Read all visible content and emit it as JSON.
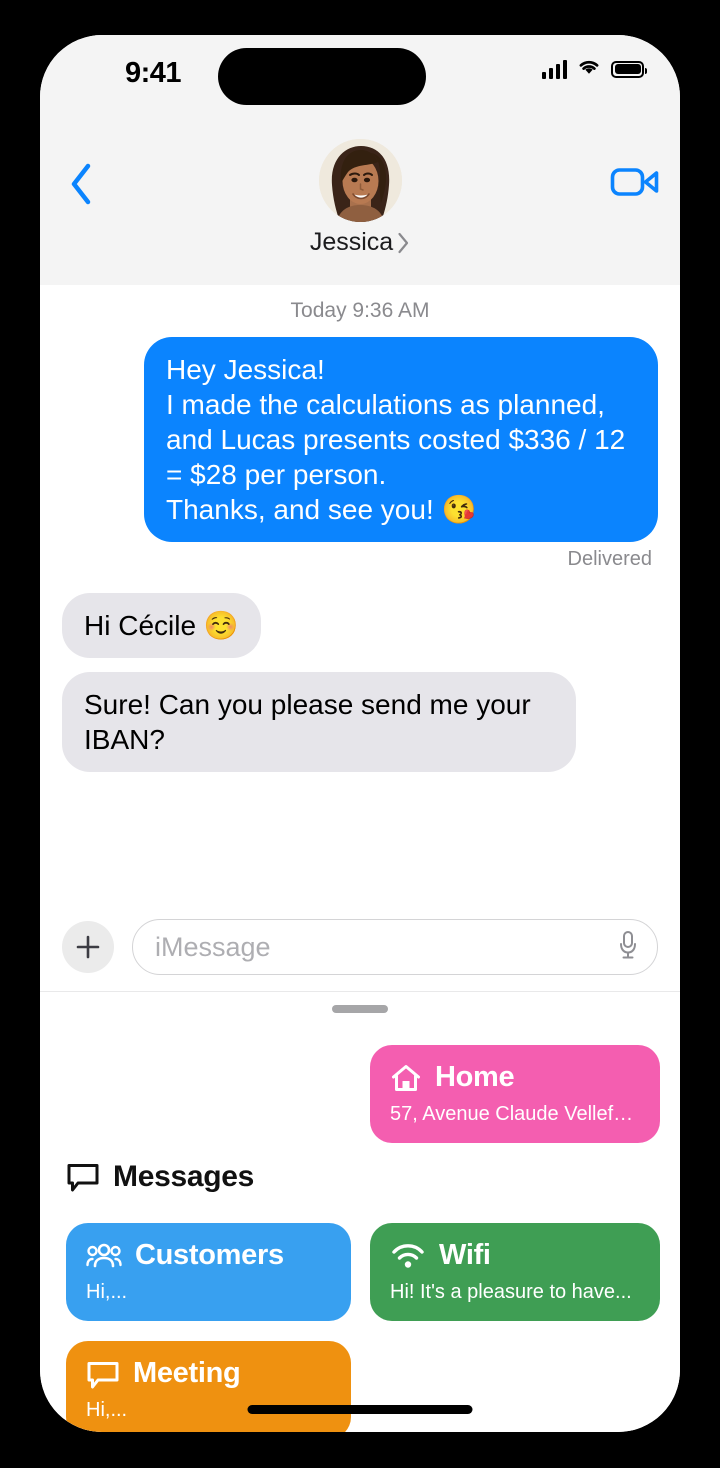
{
  "status_bar": {
    "time": "9:41",
    "signal_icon": "cellular-signal-icon",
    "wifi_icon": "wifi-icon",
    "battery_icon": "battery-icon"
  },
  "chat_header": {
    "back_icon": "back-chevron-icon",
    "contact_name": "Jessica",
    "contact_chevron_icon": "chevron-right-icon",
    "avatar_alt": "avatar",
    "video_icon": "video-camera-icon"
  },
  "conversation": {
    "day_stamp": "Today 9:36 AM",
    "delivered_label": "Delivered",
    "messages": [
      {
        "direction": "outgoing",
        "text": "Hey Jessica!\nI made the calculations as planned, and Lucas presents costed $336 / 12 = $28 per person.\nThanks, and see you! 😘"
      },
      {
        "direction": "incoming",
        "text": "Hi Cécile ☺️"
      },
      {
        "direction": "incoming",
        "text": "Sure! Can you please send me your IBAN?"
      }
    ]
  },
  "input_bar": {
    "plus_icon": "plus-icon",
    "placeholder": "iMessage",
    "value": "",
    "mic_icon": "microphone-icon"
  },
  "bottom_sheet": {
    "drag_handle": "drag-handle",
    "home_card": {
      "icon": "house-icon",
      "title": "Home",
      "subtitle": "57, Avenue Claude Vellefa...",
      "color": "#f45eb0"
    },
    "section": {
      "icon": "speech-bubble-icon",
      "title": "Messages"
    },
    "cards": [
      {
        "icon": "people-group-icon",
        "title": "Customers",
        "subtitle": "Hi,...",
        "color": "#38a0f0"
      },
      {
        "icon": "wifi-icon",
        "title": "Wifi",
        "subtitle": "Hi! It's a pleasure to have...",
        "color": "#3f9e54"
      },
      {
        "icon": "speech-bubble-icon",
        "title": "Meeting",
        "subtitle": "Hi,...",
        "color": "#ef9110"
      }
    ]
  },
  "colors": {
    "accent_blue": "#0b84fe",
    "bubble_in": "#e6e5ea",
    "header_bg": "#f4f4f4"
  }
}
